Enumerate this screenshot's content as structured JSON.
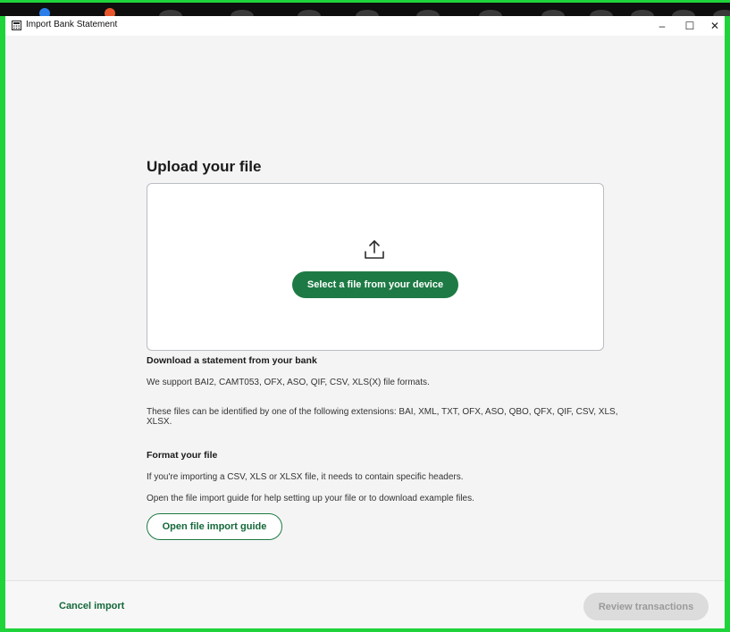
{
  "window": {
    "title": "Import Bank Statement",
    "min_glyph": "–",
    "max_glyph": "☐",
    "close_glyph": "✕"
  },
  "upload": {
    "heading": "Upload your file",
    "select_button": "Select a file from your device",
    "icon": "upload-icon"
  },
  "download_section": {
    "title": "Download a statement from your bank",
    "supported": "We support BAI2, CAMT053, OFX, ASO, QIF, CSV, XLS(X) file formats.",
    "extensions": "These files can be identified by one of the following extensions: BAI, XML, TXT, OFX, ASO, QBO, QFX, QIF, CSV, XLS, XLSX."
  },
  "format_section": {
    "title": "Format your file",
    "headers_note": "If you're importing a CSV, XLS or XLSX file, it needs to contain specific headers.",
    "guide_note": "Open the file import guide for help setting up your file or to download example files.",
    "guide_button": "Open file import guide"
  },
  "footer": {
    "cancel": "Cancel import",
    "review": "Review transactions"
  },
  "colors": {
    "primary_green": "#1e7a44",
    "disabled_bg": "#dcdcdc",
    "frame_green": "#1fd33a"
  }
}
